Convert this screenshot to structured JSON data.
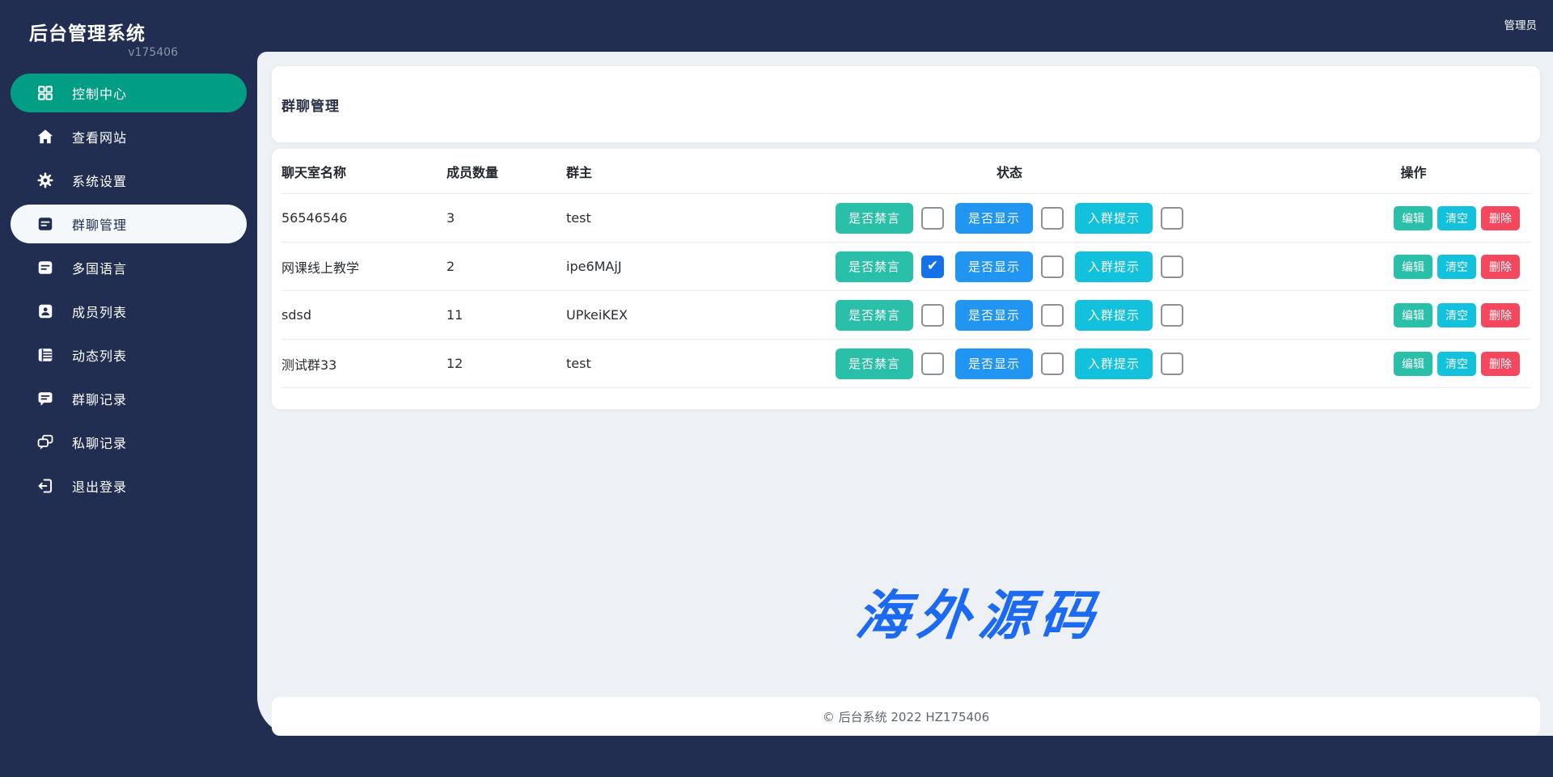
{
  "app": {
    "title": "后台管理系统",
    "version": "v175406"
  },
  "topbar": {
    "user": "管理员"
  },
  "sidebar": {
    "items": [
      {
        "label": "控制中心",
        "icon": "dashboard-icon",
        "variant": "teal"
      },
      {
        "label": "查看网站",
        "icon": "home-icon",
        "variant": "plain"
      },
      {
        "label": "系统设置",
        "icon": "gear-icon",
        "variant": "plain"
      },
      {
        "label": "群聊管理",
        "icon": "chat-manage-icon",
        "variant": "active"
      },
      {
        "label": "多国语言",
        "icon": "language-icon",
        "variant": "plain"
      },
      {
        "label": "成员列表",
        "icon": "member-list-icon",
        "variant": "plain"
      },
      {
        "label": "动态列表",
        "icon": "feed-list-icon",
        "variant": "plain"
      },
      {
        "label": "群聊记录",
        "icon": "group-chat-icon",
        "variant": "plain"
      },
      {
        "label": "私聊记录",
        "icon": "private-chat-icon",
        "variant": "plain"
      },
      {
        "label": "退出登录",
        "icon": "logout-icon",
        "variant": "plain"
      }
    ]
  },
  "page": {
    "title": "群聊管理"
  },
  "table": {
    "headers": {
      "name": "聊天室名称",
      "members": "成员数量",
      "owner": "群主",
      "status": "状态",
      "actions": "操作"
    },
    "status_buttons": [
      "是否禁言",
      "是否显示",
      "入群提示"
    ],
    "action_buttons": [
      "编辑",
      "清空",
      "删除"
    ],
    "rows": [
      {
        "name": "56546546",
        "members": "3",
        "owner": "test",
        "checks": [
          false,
          false,
          false
        ]
      },
      {
        "name": "网课线上教学",
        "members": "2",
        "owner": "ipe6MAjJ",
        "checks": [
          true,
          false,
          false
        ]
      },
      {
        "name": "sdsd",
        "members": "11",
        "owner": "UPkeiKEX",
        "checks": [
          false,
          false,
          false
        ]
      },
      {
        "name": "测试群33",
        "members": "12",
        "owner": "test",
        "checks": [
          false,
          false,
          false
        ]
      }
    ]
  },
  "watermark": {
    "text": "海外源码"
  },
  "footer": {
    "text": "© 后台系统 2022 HZ175406"
  },
  "colors": {
    "navy": "#212e52",
    "sidebar_active_teal": "#029d85",
    "button_teal": "#2abfa9",
    "button_blue": "#2095f2",
    "button_cyan": "#12c2dc",
    "button_red": "#f5485f",
    "checkbox_checked_blue": "#1571e8",
    "watermark_blue": "#1d6af2",
    "main_background": "#edf0f5"
  }
}
